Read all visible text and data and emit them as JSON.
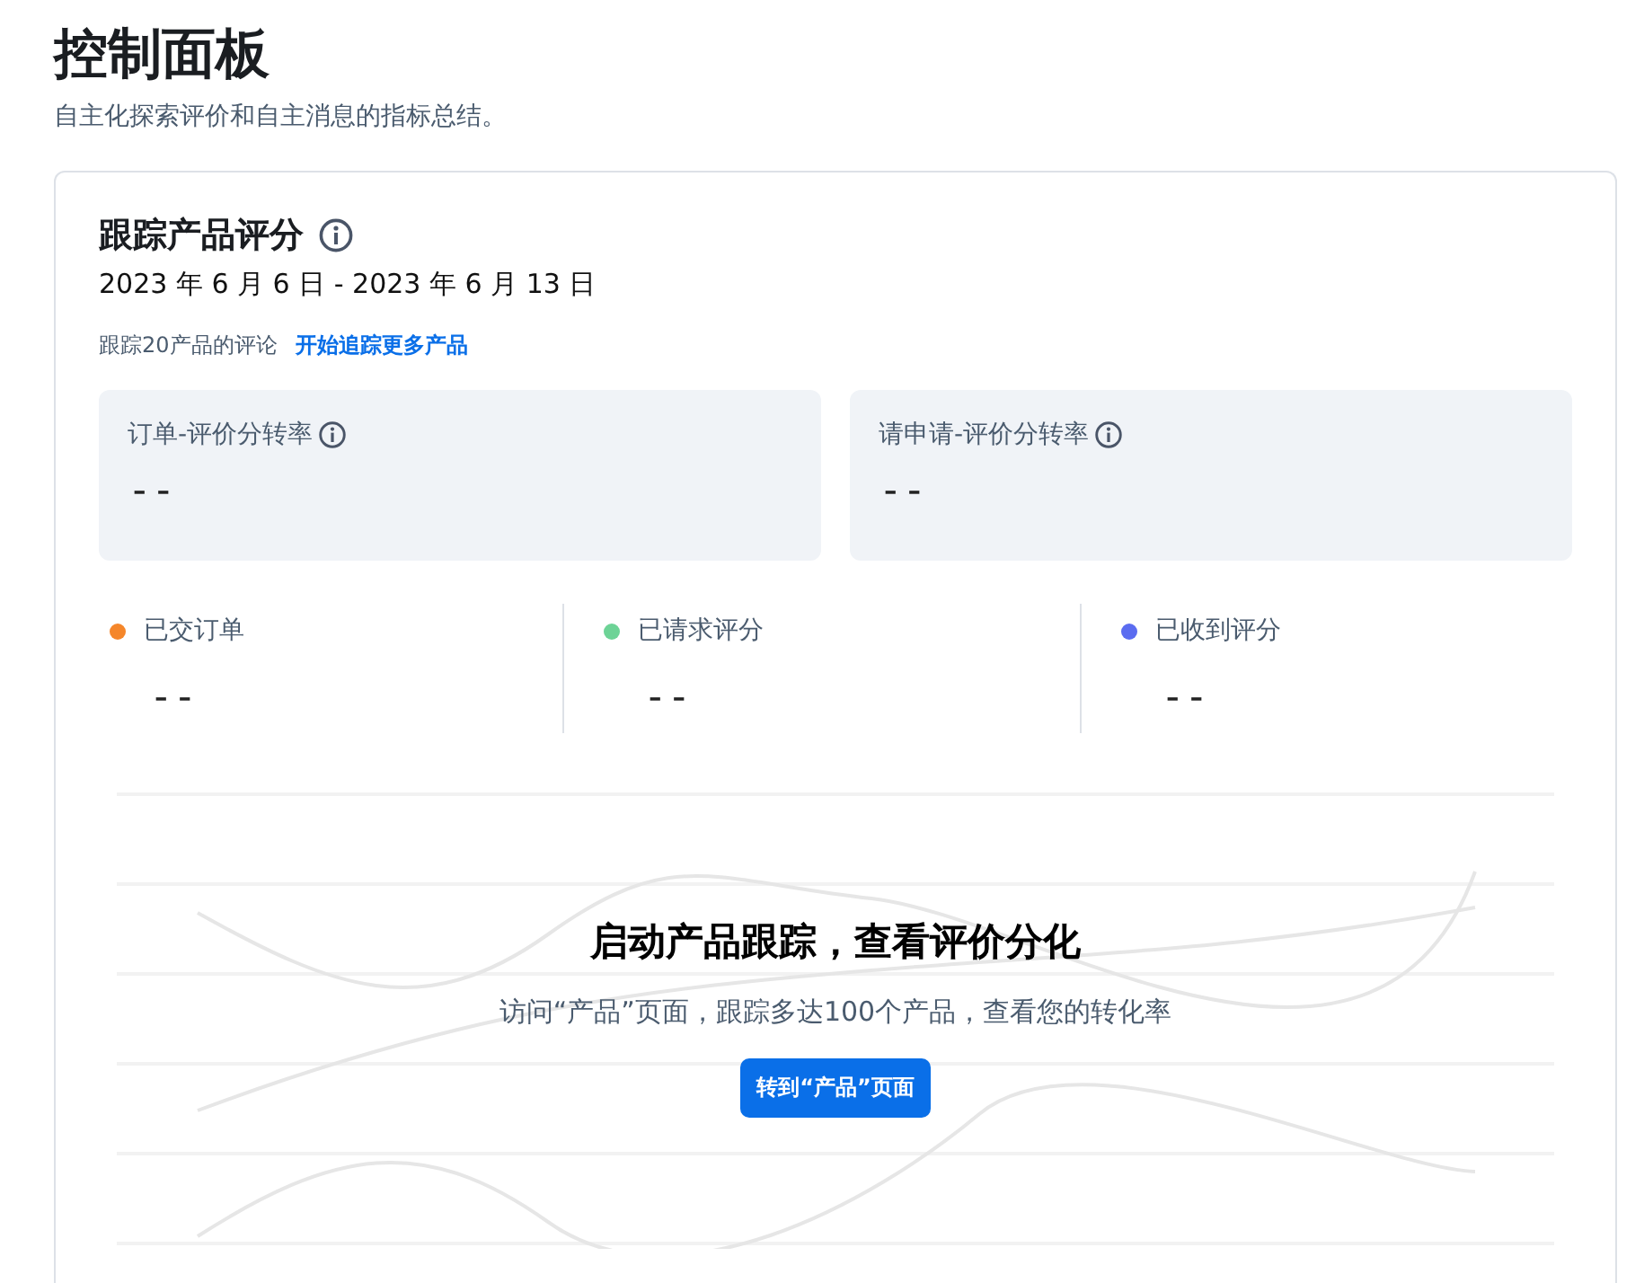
{
  "header": {
    "title": "控制面板",
    "subtitle": "自主化探索评价和自主消息的指标总结。"
  },
  "card": {
    "title": "跟踪产品评分",
    "date_range": "2023 年 6 月 6 日 - 2023 年 6 月 13 日",
    "tracking_note": "跟踪20产品的评论",
    "tracking_link": "开始追踪更多产品",
    "rates": [
      {
        "label": "订单-评价分转率",
        "value": "--"
      },
      {
        "label": "请申请-评价分转率",
        "value": "--"
      }
    ],
    "legend": [
      {
        "label": "已交订单",
        "value": "--",
        "color": "#f5862a"
      },
      {
        "label": "已请求评分",
        "value": "--",
        "color": "#6dd396"
      },
      {
        "label": "已收到评分",
        "value": "--",
        "color": "#5b6cf0"
      }
    ],
    "empty_state": {
      "title": "启动产品跟踪，查看评价分化",
      "description": "访问“产品”页面，跟踪多达100个产品，查看您的转化率",
      "button": "转到“产品”页面"
    }
  }
}
